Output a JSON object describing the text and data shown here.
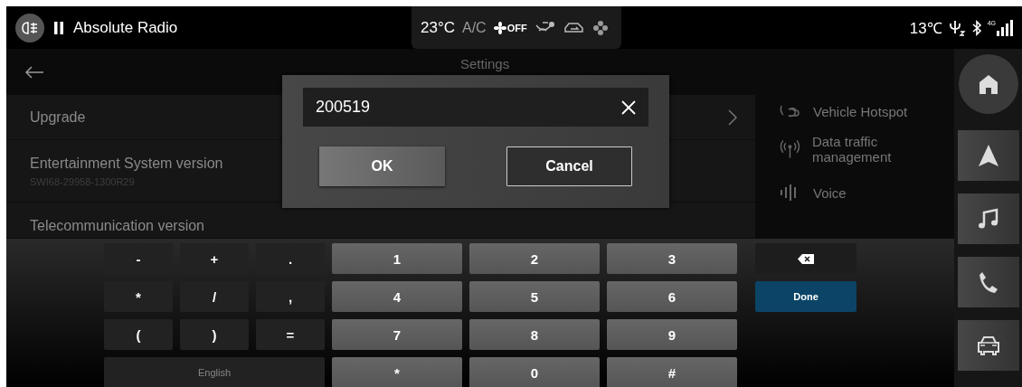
{
  "status_bar": {
    "media": {
      "playing": true,
      "station": "Absolute Radio"
    },
    "climate": {
      "temperature": "23°C",
      "ac_label": "A/C",
      "fan": "OFF"
    },
    "outside_temperature": "13℃",
    "network": "4G"
  },
  "header": {
    "title": "Settings"
  },
  "settings_rows": [
    {
      "title": "Upgrade",
      "chevron": true
    },
    {
      "title": "Entertainment System version",
      "subtitle": "SWI68-29958-1300R29",
      "chevron": false
    },
    {
      "title": "Telecommunication version",
      "chevron": false
    }
  ],
  "side_menu": [
    {
      "label": "Vehicle Hotspot"
    },
    {
      "label": "Data traffic management"
    },
    {
      "label": "Voice"
    }
  ],
  "dialog": {
    "value": "200519",
    "buttons": [
      {
        "label": "OK",
        "kind": "primary"
      },
      {
        "label": "Cancel",
        "kind": "outline"
      }
    ]
  },
  "keyboard": {
    "symbol_keys": [
      "-",
      "+",
      ".",
      "*",
      "/",
      ",",
      "(",
      ")",
      "="
    ],
    "language_key": "English",
    "number_keys": [
      "1",
      "2",
      "3",
      "4",
      "5",
      "6",
      "7",
      "8",
      "9",
      "*",
      "0",
      "#"
    ],
    "done_key": "Done"
  }
}
